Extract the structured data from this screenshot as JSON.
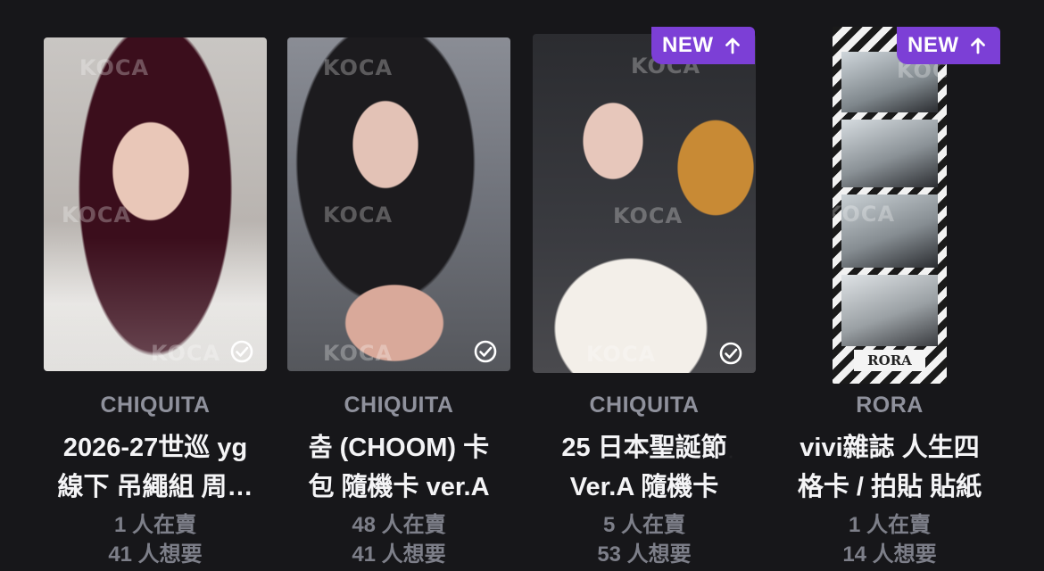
{
  "watermark": "KOCA",
  "badge_label": "NEW",
  "cards": [
    {
      "artist": "CHIQUITA",
      "title_line1": "2026-27世巡 yg",
      "title_line2": "線下 吊繩組 周…",
      "selling": "1 人在賣",
      "wanting": "41 人想要",
      "is_new": false
    },
    {
      "artist": "CHIQUITA",
      "title_line1": "춤 (CHOOM) 卡",
      "title_line2": "包 隨機卡 ver.A",
      "selling": "48 人在賣",
      "wanting": "41 人想要",
      "is_new": false
    },
    {
      "artist": "CHIQUITA",
      "title_line1": "25 日本聖誕節",
      "title_line2": "Ver.A 隨機卡",
      "selling": "5 人在賣",
      "wanting": "53 人想要",
      "is_new": true
    },
    {
      "artist": "RORA",
      "title_line1": "vivi雜誌 人生四",
      "title_line2": "格卡 / 拍貼 貼紙",
      "selling": "1 人在賣",
      "wanting": "14 人想要",
      "is_new": true
    }
  ],
  "photo_strip_text": "RORA",
  "icons": {
    "check": "check-circle-icon",
    "new_arrow": "arrow-up-icon"
  },
  "colors": {
    "background": "#17171a",
    "badge": "#7c3fd6",
    "artist_text": "#8f919c",
    "title_text": "#f4f4f6",
    "stat_text": "#7d7f89"
  }
}
